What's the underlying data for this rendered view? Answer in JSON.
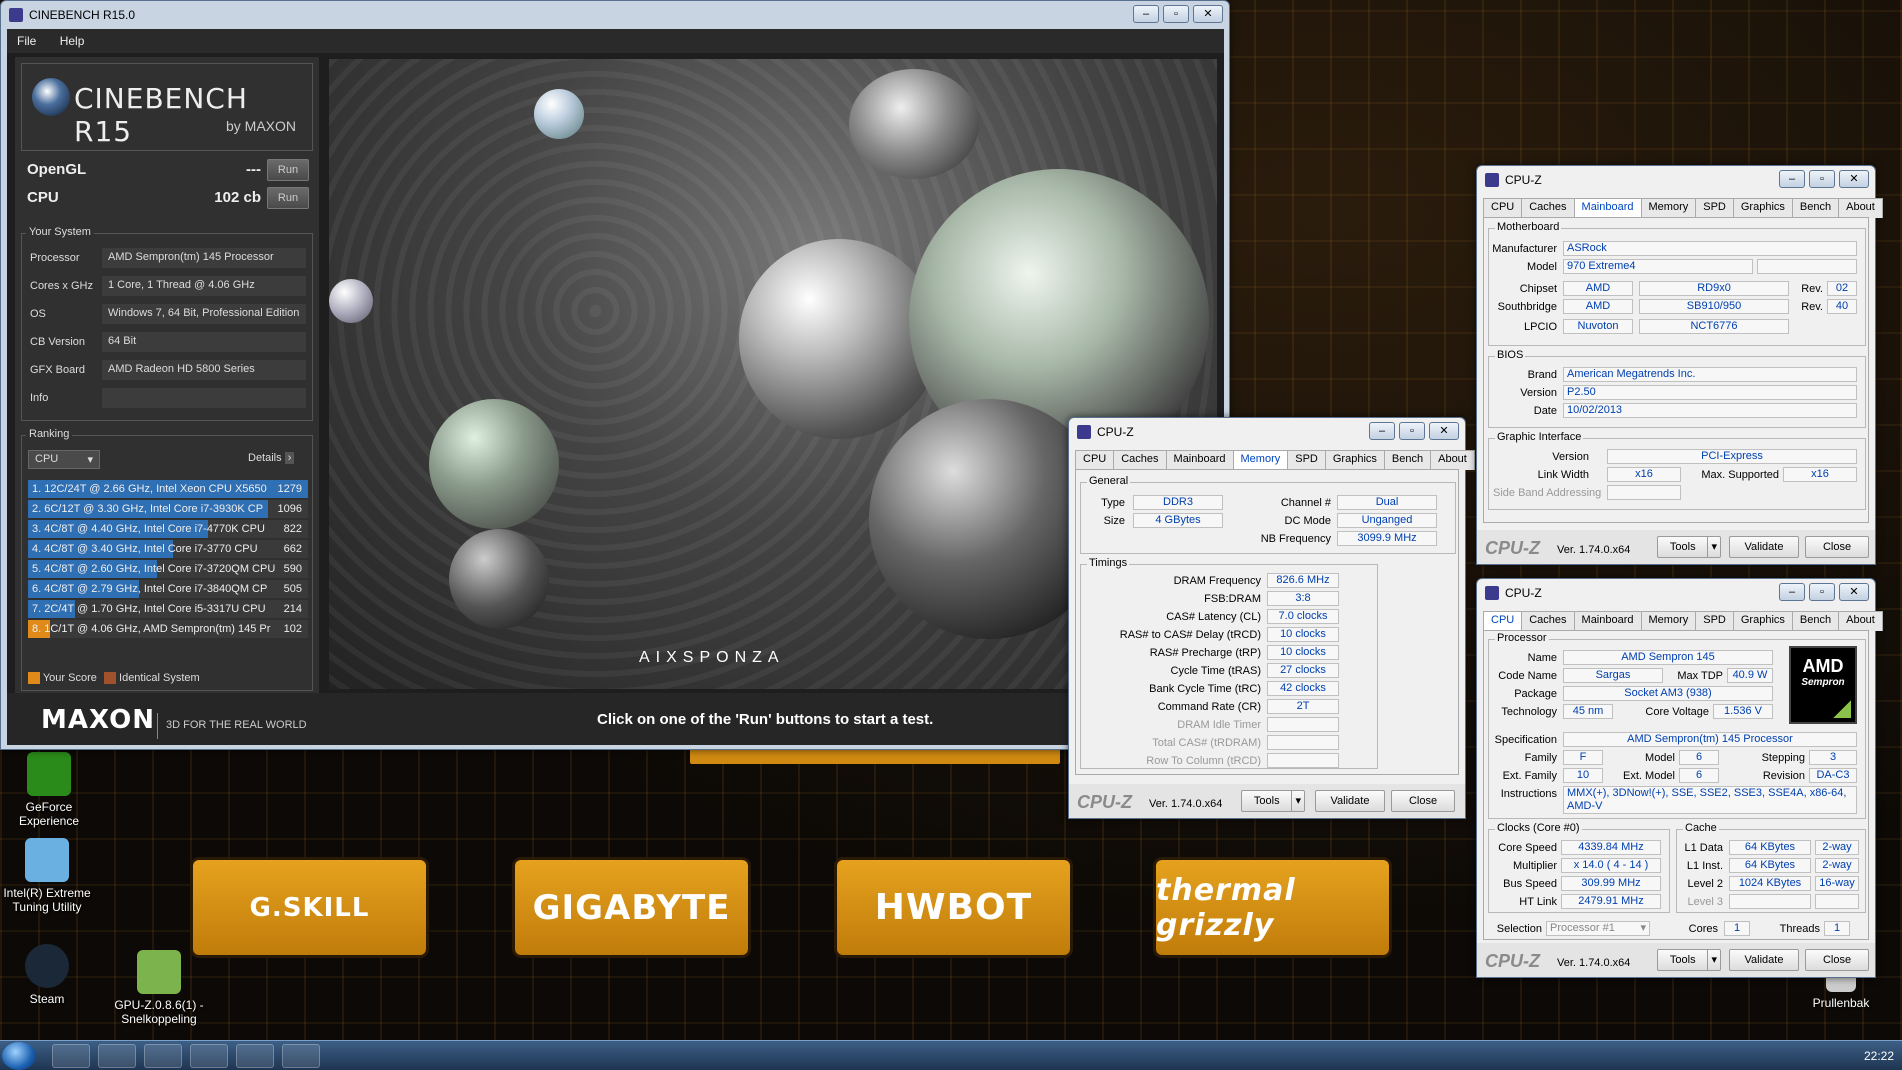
{
  "cinebench": {
    "title": "CINEBENCH R15.0",
    "menu": [
      "File",
      "Help"
    ],
    "logo_title": "CINEBENCH R15",
    "logo_sub": "by MAXON",
    "opengl_label": "OpenGL",
    "opengl_value": "---",
    "cpu_label": "CPU",
    "cpu_value": "102 cb",
    "run_label": "Run",
    "your_system": "Your System",
    "system": [
      {
        "k": "Processor",
        "v": "AMD Sempron(tm) 145 Processor"
      },
      {
        "k": "Cores x GHz",
        "v": "1 Core, 1 Thread @ 4.06 GHz"
      },
      {
        "k": "OS",
        "v": "Windows 7, 64 Bit, Professional Edition"
      },
      {
        "k": "CB Version",
        "v": "64 Bit"
      },
      {
        "k": "GFX Board",
        "v": "AMD Radeon HD 5800 Series"
      },
      {
        "k": "Info",
        "v": ""
      }
    ],
    "ranking": "Ranking",
    "ranking_select": "CPU",
    "details": "Details",
    "ranks": [
      {
        "t": "1. 12C/24T @ 2.66 GHz, Intel Xeon CPU X5650",
        "s": "1279",
        "frac": 1.0
      },
      {
        "t": "2. 6C/12T @ 3.30 GHz,  Intel Core i7-3930K CP",
        "s": "1096",
        "frac": 0.857
      },
      {
        "t": "3. 4C/8T @ 4.40 GHz, Intel Core i7-4770K CPU",
        "s": "822",
        "frac": 0.643
      },
      {
        "t": "4. 4C/8T @ 3.40 GHz,  Intel Core i7-3770 CPU",
        "s": "662",
        "frac": 0.518
      },
      {
        "t": "5. 4C/8T @ 2.60 GHz, Intel Core i7-3720QM CPU",
        "s": "590",
        "frac": 0.461
      },
      {
        "t": "6. 4C/8T @ 2.79 GHz,  Intel Core i7-3840QM CP",
        "s": "505",
        "frac": 0.395
      },
      {
        "t": "7. 2C/4T @ 1.70 GHz,  Intel Core i5-3317U CPU",
        "s": "214",
        "frac": 0.167
      },
      {
        "t": "8. 1C/1T @ 4.06 GHz, AMD Sempron(tm) 145 Pr",
        "s": "102",
        "frac": 0.08
      }
    ],
    "your_score": "Your Score",
    "identical": "Identical System",
    "maxon": "MAXON",
    "maxon_tag": "3D FOR THE REAL WORLD",
    "hint": "Click on one of the 'Run' buttons to start a test.",
    "render_credit": "AIXSPONZA"
  },
  "cpuz_common": {
    "title": "CPU-Z",
    "tabs": [
      "CPU",
      "Caches",
      "Mainboard",
      "Memory",
      "SPD",
      "Graphics",
      "Bench",
      "About"
    ],
    "logo": "CPU-Z",
    "version": "Ver. 1.74.0.x64",
    "tools": "Tools",
    "validate": "Validate",
    "close": "Close"
  },
  "mem": {
    "general": "General",
    "type_l": "Type",
    "type": "DDR3",
    "size_l": "Size",
    "size": "4 GBytes",
    "channel_l": "Channel #",
    "channel": "Dual",
    "dc_l": "DC Mode",
    "dc": "Unganged",
    "nb_l": "NB Frequency",
    "nb": "3099.9 MHz",
    "timings": "Timings",
    "rows": [
      {
        "l": "DRAM Frequency",
        "v": "826.6 MHz"
      },
      {
        "l": "FSB:DRAM",
        "v": "3:8"
      },
      {
        "l": "CAS# Latency (CL)",
        "v": "7.0 clocks"
      },
      {
        "l": "RAS# to CAS# Delay (tRCD)",
        "v": "10 clocks"
      },
      {
        "l": "RAS# Precharge (tRP)",
        "v": "10 clocks"
      },
      {
        "l": "Cycle Time (tRAS)",
        "v": "27 clocks"
      },
      {
        "l": "Bank Cycle Time (tRC)",
        "v": "42 clocks"
      },
      {
        "l": "Command Rate (CR)",
        "v": "2T"
      },
      {
        "l": "DRAM Idle Timer",
        "v": ""
      },
      {
        "l": "Total CAS# (tRDRAM)",
        "v": ""
      },
      {
        "l": "Row To Column (tRCD)",
        "v": ""
      }
    ]
  },
  "mb": {
    "motherboard": "Motherboard",
    "manufacturer_l": "Manufacturer",
    "manufacturer": "ASRock",
    "model_l": "Model",
    "model": "970 Extreme4",
    "chipset_l": "Chipset",
    "chipset_v": "AMD",
    "chipset_m": "RD9x0",
    "chipset_rev": "02",
    "south_l": "Southbridge",
    "south_v": "AMD",
    "south_m": "SB910/950",
    "south_rev": "40",
    "rev_l": "Rev.",
    "lpcio_l": "LPCIO",
    "lpcio_v": "Nuvoton",
    "lpcio_m": "NCT6776",
    "bios": "BIOS",
    "brand_l": "Brand",
    "brand": "American Megatrends Inc.",
    "version_l": "Version",
    "version": "P2.50",
    "date_l": "Date",
    "date": "10/02/2013",
    "gi": "Graphic Interface",
    "giv_l": "Version",
    "giv": "PCI-Express",
    "lw_l": "Link Width",
    "lw": "x16",
    "ms_l": "Max. Supported",
    "ms": "x16",
    "sba_l": "Side Band Addressing"
  },
  "cpu": {
    "processor": "Processor",
    "name_l": "Name",
    "name": "AMD Sempron 145",
    "code_l": "Code Name",
    "code": "Sargas",
    "tdp_l": "Max TDP",
    "tdp": "40.9 W",
    "pkg_l": "Package",
    "pkg": "Socket AM3 (938)",
    "tech_l": "Technology",
    "tech": "45 nm",
    "cv_l": "Core Voltage",
    "cv": "1.536 V",
    "spec_l": "Specification",
    "spec": "AMD Sempron(tm) 145 Processor",
    "fam_l": "Family",
    "fam": "F",
    "model_l": "Model",
    "model": "6",
    "step_l": "Stepping",
    "step": "3",
    "efam_l": "Ext. Family",
    "efam": "10",
    "emod_l": "Ext. Model",
    "emod": "6",
    "rev_l": "Revision",
    "rev": "DA-C3",
    "instr_l": "Instructions",
    "instr": "MMX(+), 3DNow!(+), SSE, SSE2, SSE3, SSE4A, x86-64, AMD-V",
    "clocks": "Clocks (Core #0)",
    "cs_l": "Core Speed",
    "cs": "4339.84 MHz",
    "mul_l": "Multiplier",
    "mul": "x 14.0 ( 4 - 14 )",
    "bus_l": "Bus Speed",
    "bus": "309.99 MHz",
    "ht_l": "HT Link",
    "ht": "2479.91 MHz",
    "cache": "Cache",
    "l1d_l": "L1 Data",
    "l1d": "64 KBytes",
    "l1d_w": "2-way",
    "l1i_l": "L1 Inst.",
    "l1i": "64 KBytes",
    "l1i_w": "2-way",
    "l2_l": "Level 2",
    "l2": "1024 KBytes",
    "l2_w": "16-way",
    "l3_l": "Level 3",
    "sel_l": "Selection",
    "sel": "Processor #1",
    "cores_l": "Cores",
    "cores": "1",
    "threads_l": "Threads",
    "threads": "1",
    "amd_logo": "AMD",
    "amd_sub": "Sempron"
  },
  "desktop": {
    "sponsors": [
      "G.SKILL",
      "GIGABYTE",
      "HWBOT",
      "thermal grizzly"
    ],
    "icons": [
      "GeForce Experience",
      "Intel(R) Extreme Tuning Utility",
      "Steam",
      "GPU-Z.0.8.6(1) - Snelkoppeling",
      "Prullenbak"
    ],
    "clock": "22:22"
  }
}
